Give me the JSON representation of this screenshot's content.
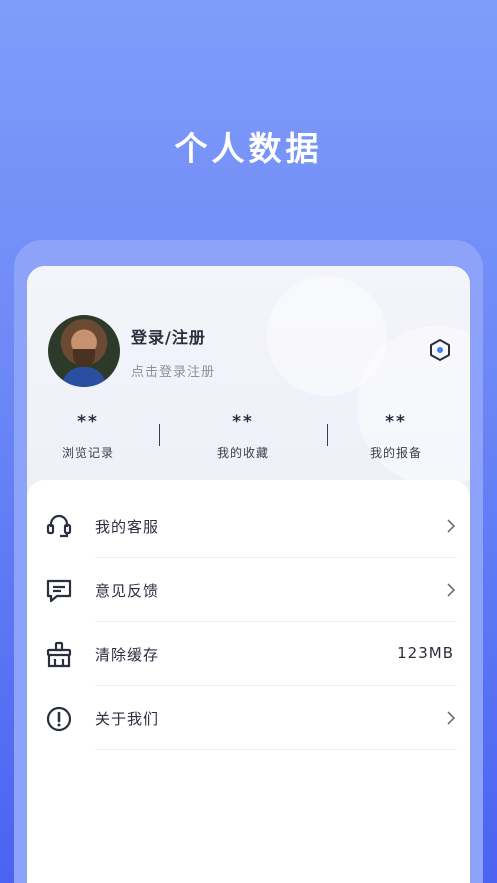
{
  "header": {
    "title": "个人数据"
  },
  "profile": {
    "login_title": "登录/注册",
    "login_subtitle": "点击登录注册",
    "avatar_icon": "avatar",
    "settings_icon": "settings-hexagon-icon"
  },
  "stats": [
    {
      "value": "**",
      "label": "浏览记录"
    },
    {
      "value": "**",
      "label": "我的收藏"
    },
    {
      "value": "**",
      "label": "我的报备"
    }
  ],
  "menu": [
    {
      "label": "我的客服",
      "icon": "headset-icon",
      "value": "",
      "has_chevron": true
    },
    {
      "label": "意见反馈",
      "icon": "message-icon",
      "value": "",
      "has_chevron": true
    },
    {
      "label": "清除缓存",
      "icon": "broom-icon",
      "value": "123MB",
      "has_chevron": false
    },
    {
      "label": "关于我们",
      "icon": "info-exclamation-icon",
      "value": "",
      "has_chevron": true
    }
  ],
  "colors": {
    "background_top": "#7f9cf9",
    "background_bottom": "#4a63f2",
    "settings_accent": "#3b82f6",
    "text_primary": "#2a2f3d"
  }
}
